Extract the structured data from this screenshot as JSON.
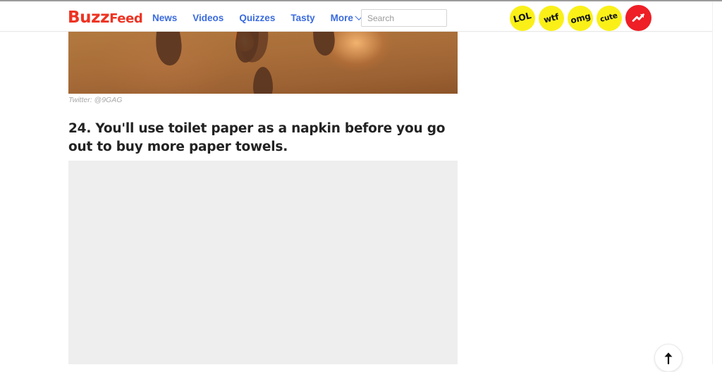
{
  "site": {
    "logo_text_buzz": "Buzz",
    "logo_text_feed": "Feed",
    "logo_color": "#ee3322"
  },
  "header": {
    "nav_items": [
      {
        "label": "News",
        "name": "nav-news"
      },
      {
        "label": "Videos",
        "name": "nav-videos"
      },
      {
        "label": "Quizzes",
        "name": "nav-quizzes"
      },
      {
        "label": "Tasty",
        "name": "nav-tasty"
      },
      {
        "label": "More",
        "name": "nav-more"
      }
    ],
    "nav_link_color": "#3a6bdd",
    "search": {
      "placeholder": "Search",
      "value": ""
    },
    "badges": [
      {
        "label": "LOL",
        "color": "#faf018"
      },
      {
        "label": "wtf",
        "color": "#faf018"
      },
      {
        "label": "omg",
        "color": "#faf018"
      },
      {
        "label": "cute",
        "color": "#faf018"
      }
    ],
    "trending_badge": {
      "icon": "trending-up-arrow",
      "color": "#ee1f26"
    }
  },
  "article": {
    "photo_credit": "Twitter: @9GAG",
    "item_number": "24.",
    "headline": "24. You'll use toilet paper as a napkin before you go out to buy more paper towels."
  },
  "controls": {
    "scroll_top_icon": "arrow-up",
    "scroll_top_label": "↑"
  }
}
